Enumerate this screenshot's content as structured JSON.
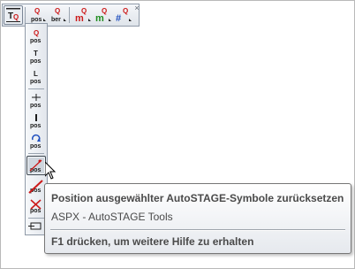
{
  "toolbar": {
    "horizontal_buttons": [
      {
        "name": "label-tool",
        "glyph": "[Q]",
        "pressed": true
      },
      {
        "name": "pos-label",
        "top": "Q",
        "bottom": "pos"
      },
      {
        "name": "ber-label",
        "top": "Q",
        "bottom": "ber"
      },
      {
        "name": "m-label-red",
        "top": "Q",
        "bottom": "m"
      },
      {
        "name": "m-label-green",
        "top": "Q",
        "bottom": "m"
      },
      {
        "name": "hash-label",
        "top": "Q",
        "bottom": "#"
      }
    ],
    "vertical_buttons": [
      {
        "name": "pos-q",
        "top": "Q",
        "bottom": "pos"
      },
      {
        "name": "pos-t",
        "top": "T",
        "bottom": "pos"
      },
      {
        "name": "pos-l",
        "top": "L",
        "bottom": "pos"
      },
      {
        "name": "pos-cross",
        "top": "+",
        "bottom": "pos"
      },
      {
        "name": "pos-bar",
        "top": "|",
        "bottom": "pos"
      },
      {
        "name": "pos-rotate",
        "top": "↻",
        "bottom": "pos"
      },
      {
        "name": "pos-reset",
        "top": "",
        "bottom": "pos"
      },
      {
        "name": "pos-strike",
        "top": "",
        "bottom": "pos"
      },
      {
        "name": "pos-delete",
        "top": "",
        "bottom": "pos"
      },
      {
        "name": "flag",
        "top": "",
        "bottom": ""
      }
    ]
  },
  "tooltip": {
    "title": "Position ausgewählter AutoSTAGE-Symbole zurücksetzen",
    "description": "ASPX - AutoSTAGE Tools",
    "help": "F1 drücken, um weitere Hilfe zu erhalten"
  },
  "colors": {
    "accent_red": "#cc1a1a",
    "accent_green": "#1e8c1e",
    "accent_blue": "#1f4fbf",
    "text_dark": "#4a4a4a"
  }
}
